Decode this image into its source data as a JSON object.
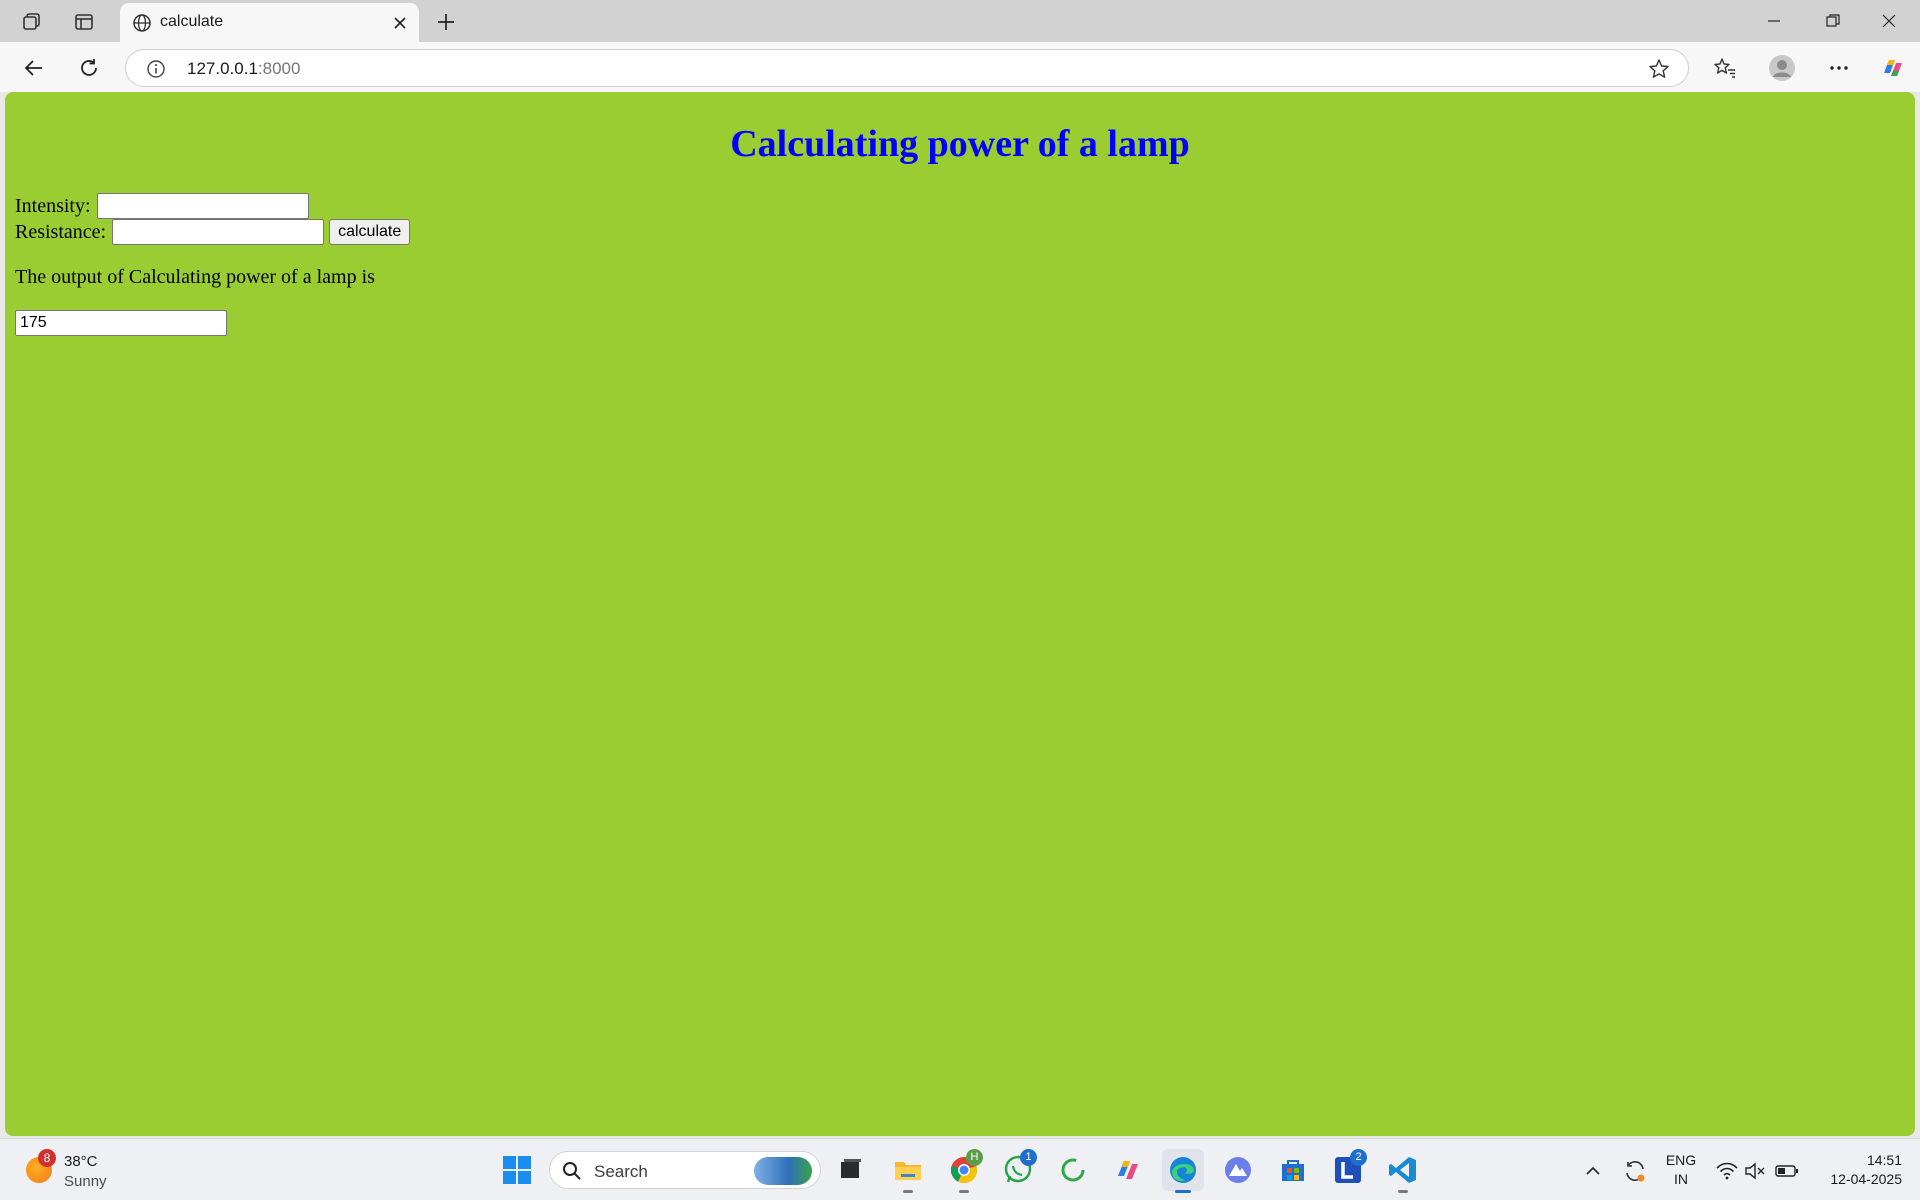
{
  "browser": {
    "tab_title": "calculate",
    "url_host": "127.0.0.1",
    "url_port": ":8000"
  },
  "page": {
    "heading": "Calculating power of a lamp",
    "intensity_label": "Intensity:",
    "intensity_value": "",
    "resistance_label": "Resistance:",
    "resistance_value": "",
    "calculate_label": "calculate",
    "output_text": "The output of Calculating power of a lamp is",
    "output_value": "175",
    "background_color": "#9acd32",
    "heading_color": "#0000ff"
  },
  "taskbar": {
    "weather": {
      "badge": "8",
      "temperature": "38°C",
      "condition": "Sunny"
    },
    "search_label": "Search",
    "chrome_badge": "H",
    "whatsapp_badge": "1",
    "lens_badge": "2",
    "language_line1": "ENG",
    "language_line2": "IN",
    "time": "14:51",
    "date": "12-04-2025"
  }
}
